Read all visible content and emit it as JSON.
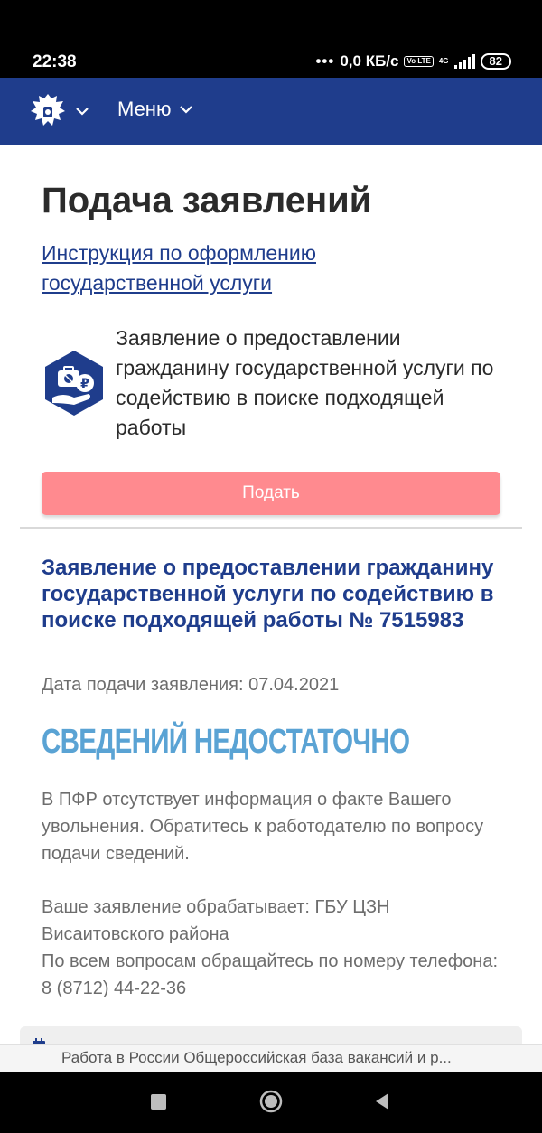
{
  "status_bar": {
    "time": "22:38",
    "dots": "•••",
    "network_speed": "0,0 КБ/с",
    "volte": "Vo LTE",
    "network_type": "4G",
    "battery": "82"
  },
  "header": {
    "menu_label": "Меню"
  },
  "page": {
    "title": "Подача заявлений",
    "instruction_link": "Инструкция по оформлению государственной услуги",
    "service_description": "Заявление о предоставлении гражданину государственной услуги по содействию в поиске подходящей работы",
    "submit_label": "Подать"
  },
  "application": {
    "title": "Заявление о предоставлении гражданину государственной услуги по содействию в поиске подходящей работы № 7515983",
    "date_line": "Дата подачи заявления: 07.04.2021",
    "status": "СВЕДЕНИЙ НЕДОСТАТОЧНО",
    "status_description": "В ПФР отсутствует информация о факте Вашего увольнения. Обратитесь к работодателю по вопросу подачи сведений.",
    "processing_line1": "Ваше заявление обрабатывает: ГБУ ЦЗН Висаитовского района",
    "processing_line2": "По всем вопросам обращайтесь по номеру телефона: 8 (8712) 44-22-36"
  },
  "browser_hint": {
    "text": "Работа в России Общероссийская база вакансий и р..."
  },
  "colors": {
    "header_bg": "#1f3d8c",
    "accent_blue": "#1f3d8c",
    "submit_button": "#ff8a8f",
    "status_color": "#5aa3d4"
  },
  "icons": {
    "emblem": "coat-of-arms-icon",
    "menu_chevron": "chevron-down-icon",
    "service": "employment-service-icon",
    "calendar": "calendar-icon"
  }
}
